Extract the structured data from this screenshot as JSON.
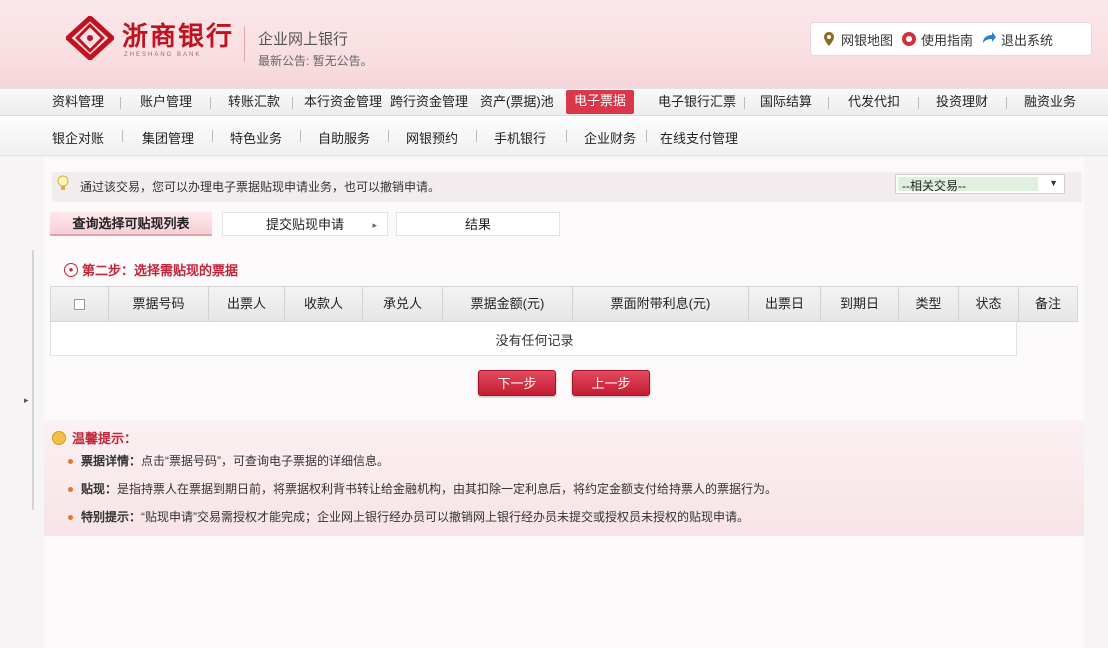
{
  "header": {
    "bank_name": "浙商银行",
    "bank_sub": "ZHESHANG BANK",
    "system_title": "企业网上银行",
    "notice": "最新公告: 暂无公告。",
    "top_links": [
      {
        "label": "网银地图",
        "icon": "map-pin-icon"
      },
      {
        "label": "使用指南",
        "icon": "help-icon"
      },
      {
        "label": "退出系统",
        "icon": "logout-icon"
      }
    ],
    "colors": {
      "brand": "#c1121f",
      "accent": "#d9374a"
    }
  },
  "nav_primary": [
    {
      "label": "资料管理"
    },
    {
      "label": "账户管理"
    },
    {
      "label": "转账汇款"
    },
    {
      "label": "本行资金管理"
    },
    {
      "label": "跨行资金管理"
    },
    {
      "label": "资产(票据)池"
    },
    {
      "label": "电子票据",
      "active": true
    },
    {
      "label": "电子银行汇票"
    },
    {
      "label": "国际结算"
    },
    {
      "label": "代发代扣"
    },
    {
      "label": "投资理财"
    },
    {
      "label": "融资业务"
    }
  ],
  "nav_secondary": [
    {
      "label": "银企对账"
    },
    {
      "label": "集团管理"
    },
    {
      "label": "特色业务"
    },
    {
      "label": "自助服务"
    },
    {
      "label": "网银预约"
    },
    {
      "label": "手机银行"
    },
    {
      "label": "企业财务"
    },
    {
      "label": "在线支付管理"
    }
  ],
  "info_bar": {
    "text": "通过该交易，您可以办理电子票据贴现申请业务，也可以撤销申请。",
    "select_value": "--相关交易--"
  },
  "steps": [
    {
      "label": "查询选择可贴现列表"
    },
    {
      "label": "提交贴现申请"
    },
    {
      "label": "结果"
    }
  ],
  "section_title": "第二步：选择需贴现的票据",
  "table": {
    "columns": [
      "",
      "票据号码",
      "出票人",
      "收款人",
      "承兑人",
      "票据金额(元)",
      "票面附带利息(元)",
      "出票日",
      "到期日",
      "类型",
      "状态",
      "备注"
    ],
    "empty_text": "没有任何记录"
  },
  "buttons": {
    "next": "下一步",
    "prev": "上一步"
  },
  "tips": {
    "title": "温馨提示：",
    "items": [
      {
        "key": "票据详情：",
        "text": "点击“票据号码”，可查询电子票据的详细信息。"
      },
      {
        "key": "贴现：",
        "text": "是指持票人在票据到期日前，将票据权利背书转让给金融机构，由其扣除一定利息后，将约定金额支付给持票人的票据行为。"
      },
      {
        "key": "特别提示：",
        "text": "“贴现申请”交易需授权才能完成；企业网上银行经办员可以撤销网上银行经办员未提交或授权员未授权的贴现申请。"
      }
    ]
  }
}
